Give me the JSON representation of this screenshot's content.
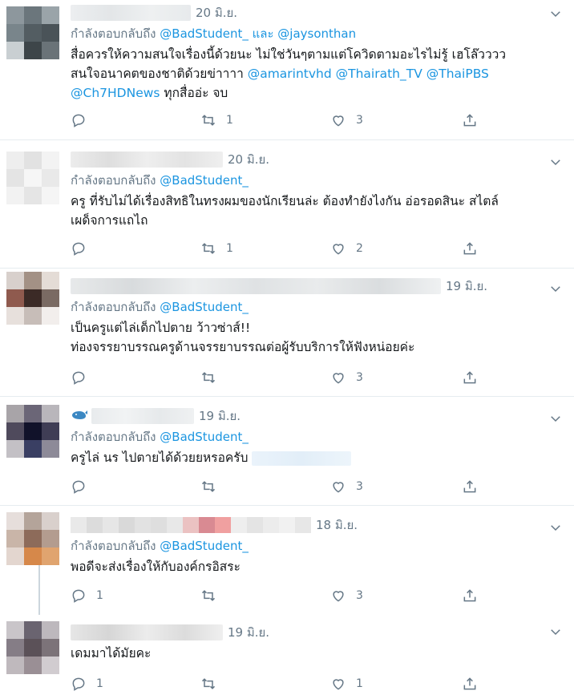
{
  "icons": {
    "reply": "reply-icon",
    "retweet": "retweet-icon",
    "like": "heart-icon",
    "share": "share-icon",
    "menu": "chevron-down-icon"
  },
  "colors": {
    "link": "#1b95e0",
    "muted": "#657786",
    "text": "#14171a",
    "border": "#e6ecf0"
  },
  "tweets": [
    {
      "date": "20 มิ.ย.",
      "reply_prefix": "กำลังตอบกลับถึง",
      "reply_mention_1": "@BadStudent_",
      "reply_and": " และ ",
      "reply_mention_2": "@jaysonthan",
      "line1": "สื่อควรให้ความสนใจเรื่องนี้ด้วยนะ ไม่ใช่วันๆตามแต่โควิดตามอะไรไม่รู้ เฮโล๊วววว",
      "line2_text": "สนใจอนาคตของชาติด้วยข่าาาา ",
      "line2_mentions": "@amarintvhd @Thairath_TV @ThaiPBS",
      "line3_mention": "@Ch7HDNews",
      "line3_text": " ทุกสื่ออ่ะ จบ",
      "reply_count": "",
      "retweet_count": "1",
      "like_count": "3"
    },
    {
      "date": "20 มิ.ย.",
      "reply_prefix": "กำลังตอบกลับถึง",
      "reply_mention_1": "@BadStudent_",
      "line1": "ครู ที่รับไม่ได้เรื่องสิทธิในทรงผมของนักเรียนล่ะ ต้องทำยังไงกัน อ่อรอดสินะ สไตล์",
      "line2": "เผด็จการแถไถ",
      "reply_count": "",
      "retweet_count": "1",
      "like_count": "2"
    },
    {
      "date": "19 มิ.ย.",
      "reply_prefix": "กำลังตอบกลับถึง",
      "reply_mention_1": "@BadStudent_",
      "line1": "เป็นครูแต่ไล่เด็กไปตาย ว้าวซ่าส์!!",
      "line2": "ท่องจรรยาบรรณครูด้านจรรยาบรรณต่อผู้รับบริการให้ฟังหน่อยค่ะ",
      "reply_count": "",
      "retweet_count": "",
      "like_count": "3"
    },
    {
      "date": "19 มิ.ย.",
      "reply_prefix": "กำลังตอบกลับถึง",
      "reply_mention_1": "@BadStudent_",
      "line1": "ครูไล่ นร ไปตายได้ด้วยยหรอครับ",
      "reply_count": "",
      "retweet_count": "",
      "like_count": "3"
    },
    {
      "date": "18 มิ.ย.",
      "reply_prefix": "กำลังตอบกลับถึง",
      "reply_mention_1": "@BadStudent_",
      "line1": "พอดีจะส่งเรื่องให้กับองค์กรอิสระ",
      "reply_count": "1",
      "retweet_count": "",
      "like_count": "3"
    },
    {
      "date": "19 มิ.ย.",
      "line1": "เดมมาได้มัยคะ",
      "reply_count": "1",
      "retweet_count": "",
      "like_count": "1"
    }
  ]
}
